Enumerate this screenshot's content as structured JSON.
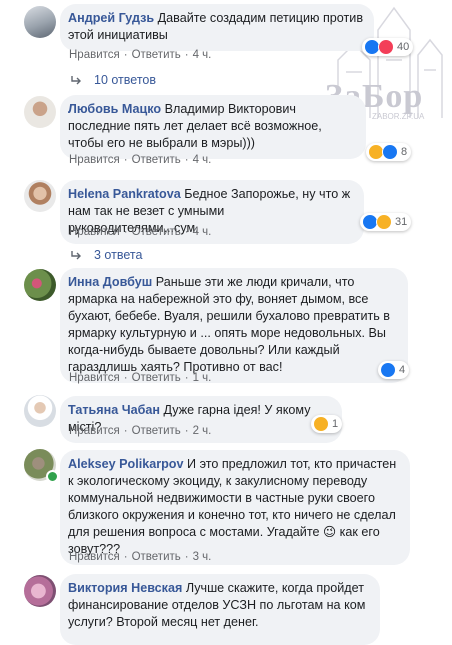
{
  "watermark": {
    "title": "ЗаБор",
    "url": "ZABOR.ZP.UA"
  },
  "comments": [
    {
      "author": "Андрей Гудзь",
      "text": "Давайте создадим петицию против этой инициативы",
      "like": "Нравится",
      "reply": "Ответить",
      "time": "4 ч.",
      "reaction_icons": [
        "like-icon",
        "love-icon"
      ],
      "reaction_count": "40",
      "replies_label": "10 ответов"
    },
    {
      "author": "Любовь Мацко",
      "text": "Владимир Викторович последние пять лет делает всё возможное, чтобы его не выбрали в мэры)))",
      "like": "Нравится",
      "reply": "Ответить",
      "time": "4 ч.",
      "reaction_icons": [
        "haha-icon",
        "like-icon"
      ],
      "reaction_count": "8"
    },
    {
      "author": "Helena Pankratova",
      "text": "Бедное Запорожье, ну что ж нам так не везет с умными руководителями...сум.",
      "like": "Нравится",
      "reply": "Ответить",
      "time": "4 ч.",
      "reaction_icons": [
        "like-icon",
        "sad-icon"
      ],
      "reaction_count": "31",
      "replies_label": "3 ответа"
    },
    {
      "author": "Инна Довбуш",
      "text": "Раньше эти же люди кричали, что ярмарка на набережной это фу, воняет дымом, все бухают, бебебе. Вуаля, решили бухалово превратить в ярмарку культурную и ... опять море недовольных. Вы когда-нибудь бываете довольны? Или каждый гараздлишь хаять? Противно от вас!",
      "like": "Нравится",
      "reply": "Ответить",
      "time": "1 ч.",
      "reaction_icons": [
        "like-icon"
      ],
      "reaction_count": "4"
    },
    {
      "author": "Татьяна Чабан",
      "text": "Дуже гарна ідея! У якому місті?",
      "like": "Нравится",
      "reply": "Ответить",
      "time": "2 ч.",
      "reaction_icons": [
        "haha-icon"
      ],
      "reaction_count": "1"
    },
    {
      "author": "Aleksey Polikarpov",
      "text": "И это предложил тот, кто причастен к экологическому экоциду, к закулисному переводу коммунальной недвижимости в частные руки своего близкого окружения и конечно тот, кто ничего не сделал для решения вопроса с мостами. Угадайте 😉 как его зовут???",
      "like": "Нравится",
      "reply": "Ответить",
      "time": "3 ч."
    },
    {
      "author": "Виктория Невская",
      "text": "Лучше скажите, когда пройдет финансирование отделов УСЗН по льготам на ком услуги? Второй месяц нет денег."
    }
  ]
}
